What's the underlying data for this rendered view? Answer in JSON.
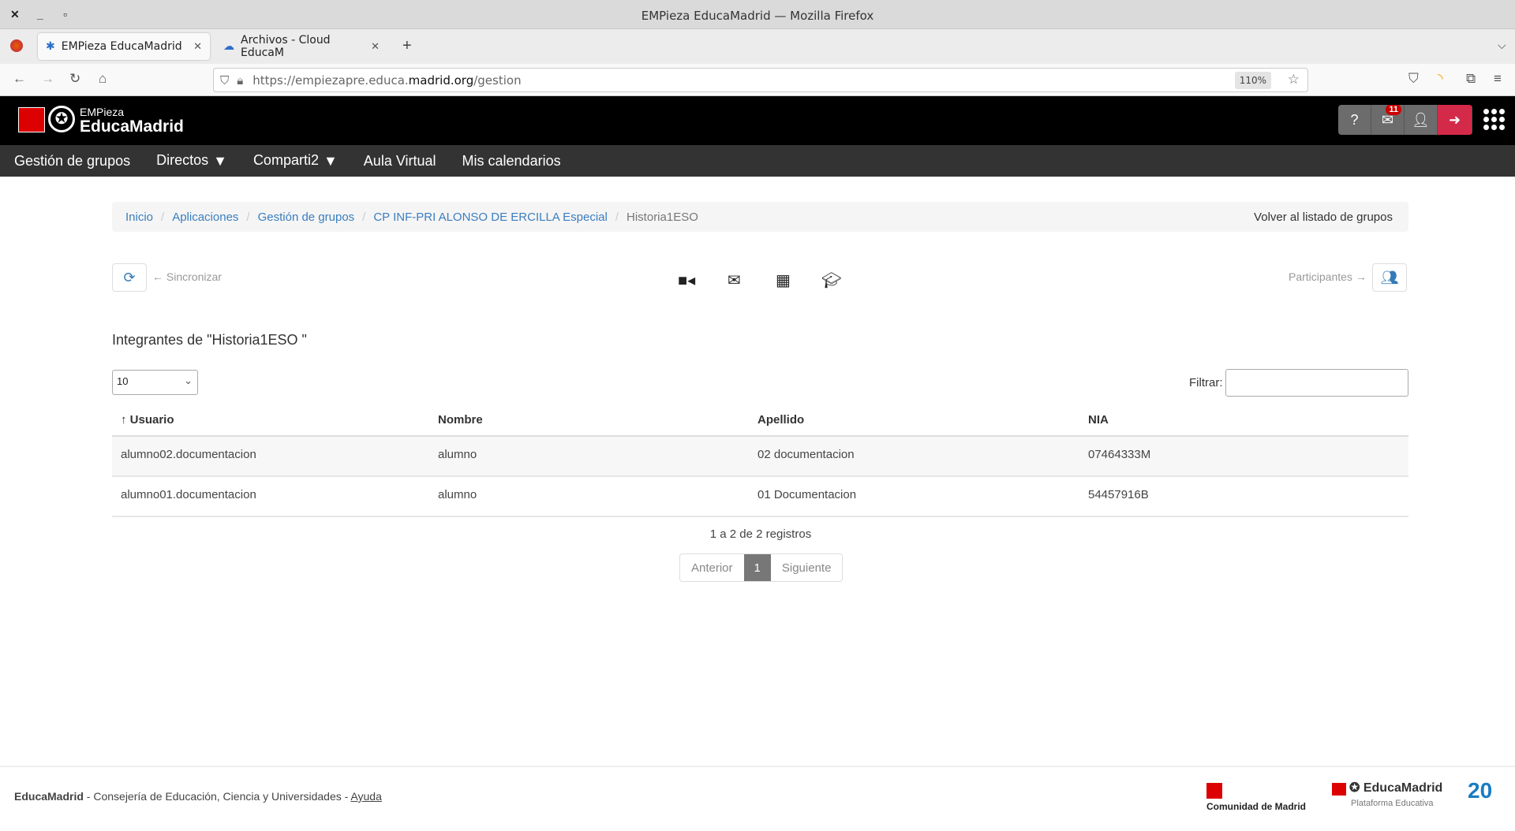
{
  "window": {
    "title": "EMPieza EducaMadrid — Mozilla Firefox"
  },
  "browser": {
    "tabs": [
      {
        "label": "EMPieza EducaMadrid"
      },
      {
        "label": "Archivos - Cloud EducaM"
      }
    ],
    "url_prefix": "https://empiezapre.educa.",
    "url_domain": "madrid.org",
    "url_path": "/gestion",
    "zoom": "110%"
  },
  "header": {
    "logo_top": "EMPieza",
    "logo_bottom": "EducaMadrid",
    "notifications": "11",
    "accent": "#d42a4a"
  },
  "menu": [
    {
      "label": "Gestión de grupos"
    },
    {
      "label": "Directos"
    },
    {
      "label": "Comparti2"
    },
    {
      "label": "Aula Virtual"
    },
    {
      "label": "Mis calendarios"
    }
  ],
  "breadcrumb": {
    "items": [
      "Inicio",
      "Aplicaciones",
      "Gestión de grupos",
      "CP INF-PRI ALONSO DE ERCILLA Especial"
    ],
    "current": "Historia1ESO",
    "back": "Volver al listado de grupos"
  },
  "toolbar": {
    "sync_hint": "← Sincronizar",
    "participants_hint": "Participantes →"
  },
  "main": {
    "heading": "Integrantes de \"Historia1ESO \"",
    "page_length": "10",
    "filter_label": "Filtrar:",
    "filter_value": "",
    "columns": [
      "↑ Usuario",
      "Nombre",
      "Apellido",
      "NIA"
    ],
    "rows": [
      [
        "alumno02.documentacion",
        "alumno",
        "02 documentacion",
        "07464333M"
      ],
      [
        "alumno01.documentacion",
        "alumno",
        "01 Documentacion",
        "54457916B"
      ]
    ],
    "info": "1 a 2 de 2 registros",
    "pager": {
      "prev": "Anterior",
      "current": "1",
      "next": "Siguiente"
    }
  },
  "footer": {
    "brand": "EducaMadrid",
    "text": " - Consejería de Educación, Ciencia y Universidades - ",
    "help": "Ayuda",
    "logos": {
      "comunidad": "Comunidad de Madrid",
      "educamadrid": "EducaMadrid",
      "plataforma": "Plataforma Educativa",
      "aniversario": "20"
    }
  }
}
